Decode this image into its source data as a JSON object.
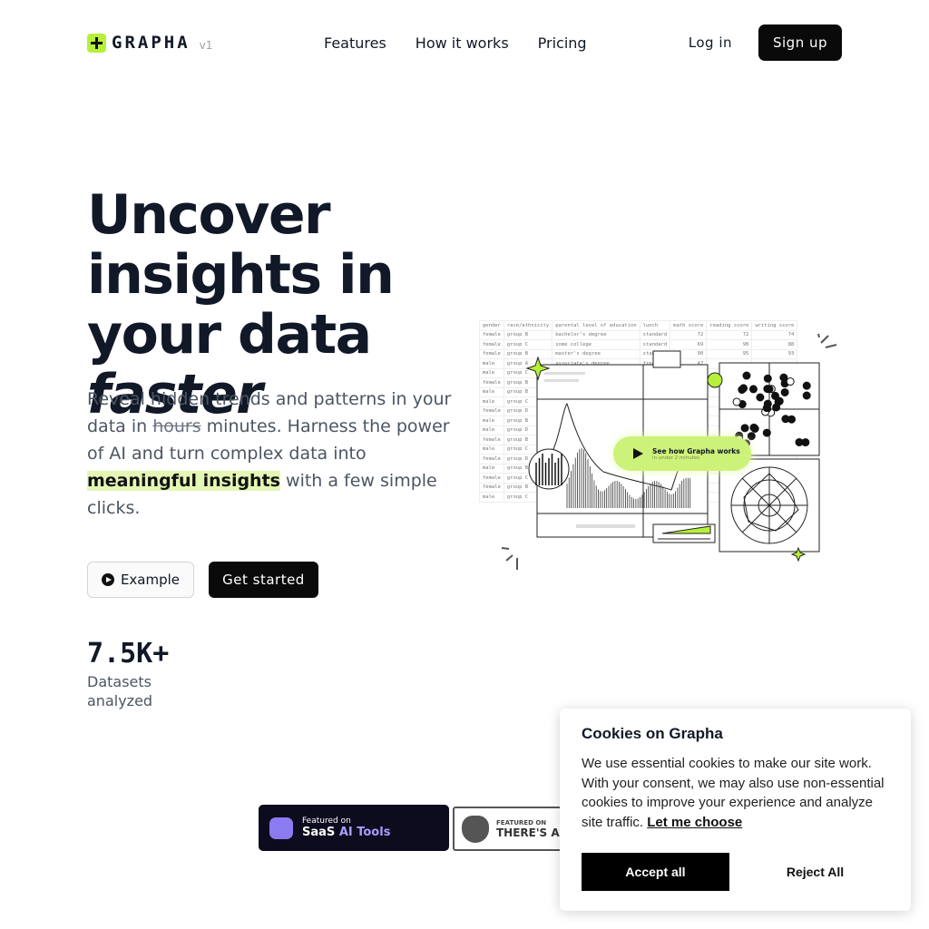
{
  "nav": {
    "brand": "GRAPHA",
    "version": "v1",
    "links": [
      "Features",
      "How it works",
      "Pricing"
    ],
    "login": "Log in",
    "signup": "Sign up"
  },
  "hero": {
    "title_line1": "Uncover insights in your data ",
    "title_em": "faster",
    "lead_1": "Reveal hidden trends and patterns in your data in ",
    "lead_strike": "hours",
    "lead_2": " minutes. Harness the power of AI and turn complex data into ",
    "lead_hl": "meaningful insights",
    "lead_3": " with a few simple clicks.",
    "example_button": "Example",
    "get_started_button": "Get started"
  },
  "stats": {
    "value": "7.5K+",
    "label": "Datasets analyzed"
  },
  "illustration": {
    "table_headers": [
      "gender",
      "race/ethnicity",
      "parental level of education",
      "lunch",
      "math score",
      "reading score",
      "writing score"
    ],
    "table_rows": [
      [
        "female",
        "group B",
        "bachelor's degree",
        "standard",
        "72",
        "72",
        "74"
      ],
      [
        "female",
        "group C",
        "some college",
        "standard",
        "69",
        "90",
        "88"
      ],
      [
        "female",
        "group B",
        "master's degree",
        "standard",
        "90",
        "95",
        "93"
      ],
      [
        "male",
        "group A",
        "associate's degree",
        "free",
        "47",
        "",
        ""
      ],
      [
        "male",
        "group C",
        "",
        "",
        "",
        "",
        ""
      ],
      [
        "female",
        "group B",
        "",
        "",
        "",
        "",
        ""
      ],
      [
        "male",
        "group B",
        "",
        "",
        "",
        "",
        ""
      ],
      [
        "male",
        "group C",
        "",
        "",
        "",
        "",
        ""
      ],
      [
        "female",
        "group D",
        "",
        "",
        "",
        "",
        ""
      ],
      [
        "male",
        "group B",
        "",
        "",
        "",
        "",
        ""
      ],
      [
        "male",
        "group D",
        "",
        "",
        "",
        "",
        ""
      ],
      [
        "female",
        "group B",
        "",
        "",
        "",
        "",
        ""
      ],
      [
        "male",
        "group C",
        "",
        "",
        "",
        "",
        ""
      ],
      [
        "female",
        "group D",
        "",
        "",
        "",
        "",
        ""
      ],
      [
        "male",
        "group B",
        "",
        "",
        "",
        "",
        ""
      ],
      [
        "female",
        "group C",
        "",
        "",
        "",
        "",
        ""
      ],
      [
        "female",
        "group B",
        "",
        "",
        "",
        "",
        ""
      ],
      [
        "male",
        "group C",
        "",
        "",
        "",
        "",
        ""
      ]
    ],
    "cta_title": "See how Grapha works",
    "cta_sub": "in under 2 minutes"
  },
  "badges": {
    "saas_small": "Featured on",
    "saas_name": "SaaS",
    "saas_accent": "AI Tools",
    "tan_small": "FEATURED ON",
    "tan_name": "THERE'S AN"
  },
  "cookie": {
    "title": "Cookies on Grapha",
    "body": "We use essential cookies to make our site work. With your consent, we may also use non-essential cookies to improve your experience and analyze site traffic. ",
    "link": "Let me choose",
    "accept": "Accept all",
    "reject": "Reject All"
  },
  "colors": {
    "accent": "#b6f03a",
    "highlight": "#e4f7b5",
    "dark": "#0a0a0a"
  }
}
